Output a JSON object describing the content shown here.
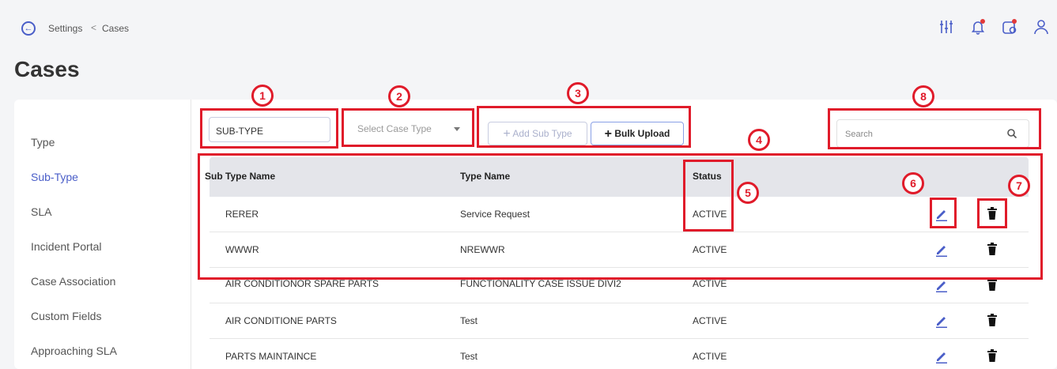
{
  "breadcrumb": {
    "back_icon": "back-circle-icon",
    "parent": "Settings",
    "separator": "<",
    "current": "Cases"
  },
  "header": {
    "icons": [
      "sliders-icon",
      "bell-icon",
      "calendar-icon",
      "user-icon"
    ]
  },
  "page": {
    "title": "Cases"
  },
  "sidebar": {
    "items": [
      {
        "label": "Type",
        "active": false
      },
      {
        "label": "Sub-Type",
        "active": true
      },
      {
        "label": "SLA",
        "active": false
      },
      {
        "label": "Incident Portal",
        "active": false
      },
      {
        "label": "Case Association",
        "active": false
      },
      {
        "label": "Custom Fields",
        "active": false
      },
      {
        "label": "Approaching SLA",
        "active": false
      }
    ]
  },
  "toolbar": {
    "subtype_value": "SUB-TYPE",
    "case_type_placeholder": "Select Case Type",
    "add_sub_type_label": "Add Sub Type",
    "bulk_upload_label": "Bulk Upload",
    "search_placeholder": "Search"
  },
  "table": {
    "headers": [
      "Sub Type Name",
      "Type Name",
      "Status"
    ],
    "rows": [
      {
        "sub_type": "RERER",
        "type": "Service Request",
        "status": "ACTIVE"
      },
      {
        "sub_type": "WWWR",
        "type": "NREWWR",
        "status": "ACTIVE"
      },
      {
        "sub_type": "AIR CONDITIONOR SPARE PARTS",
        "type": "FUNCTIONALITY CASE ISSUE DIVI2",
        "status": "ACTIVE"
      },
      {
        "sub_type": "AIR CONDITIONE PARTS",
        "type": "Test",
        "status": "ACTIVE"
      },
      {
        "sub_type": "PARTS MAINTAINCE",
        "type": "Test",
        "status": "ACTIVE"
      }
    ]
  },
  "annotations": [
    "1",
    "2",
    "3",
    "4",
    "5",
    "6",
    "7",
    "8"
  ],
  "colors": {
    "accent": "#4a5ec8",
    "annotation": "#e01b2a",
    "header_bg": "#e4e5ea"
  }
}
